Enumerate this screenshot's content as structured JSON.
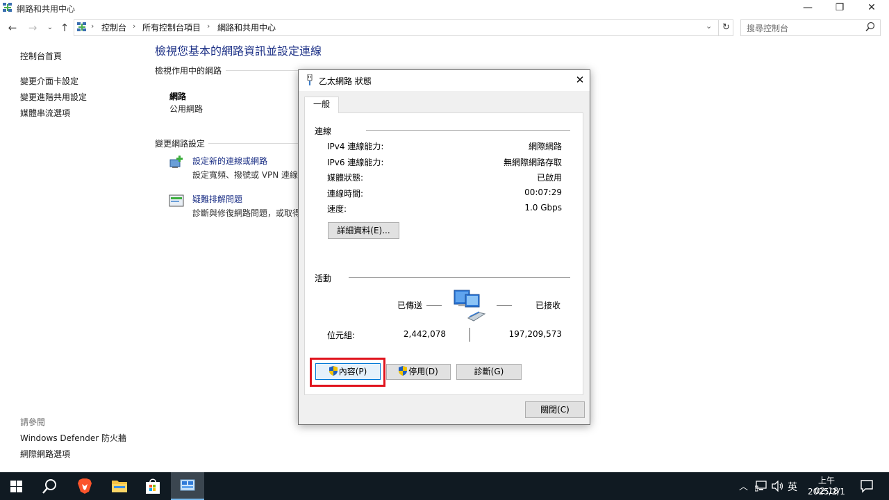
{
  "window": {
    "title": "網路和共用中心",
    "minimize_glyph": "—",
    "maximize_glyph": "❐",
    "close_glyph": "✕"
  },
  "address": {
    "crumbs": [
      "控制台",
      "所有控制台項目",
      "網路和共用中心"
    ],
    "separator": "›"
  },
  "search": {
    "placeholder": "搜尋控制台"
  },
  "leftnav": {
    "home": "控制台首頁",
    "links": [
      "變更介面卡設定",
      "變更進階共用設定",
      "媒體串流選項"
    ],
    "see_also_label": "請參閱",
    "see_also": [
      "Windows Defender 防火牆",
      "網際網路選項"
    ]
  },
  "main": {
    "title": "檢視您基本的網路資訊並設定連線",
    "active_networks_heading": "檢視作用中的網路",
    "network_name": "網路",
    "network_type": "公用網路",
    "change_settings_heading": "變更網路設定",
    "tasks": [
      {
        "link": "設定新的連線或網路",
        "desc": "設定寬頻、撥號或 VPN 連線"
      },
      {
        "link": "疑難排解問題",
        "desc": "診斷與修復網路問題，或取得"
      }
    ]
  },
  "dialog": {
    "title": "乙太網路 狀態",
    "tab": "一般",
    "connection_group": "連線",
    "rows": [
      {
        "key": "IPv4 連線能力:",
        "value": "網際網路"
      },
      {
        "key": "IPv6 連線能力:",
        "value": "無網際網路存取"
      },
      {
        "key": "媒體狀態:",
        "value": "已啟用"
      },
      {
        "key": "連線時間:",
        "value": "00:07:29"
      },
      {
        "key": "速度:",
        "value": "1.0 Gbps"
      }
    ],
    "details_button": "詳細資料(E)...",
    "activity_group": "活動",
    "sent_label": "已傳送",
    "received_label": "已接收",
    "bytes_label": "位元組:",
    "bytes_sent": "2,442,078",
    "bytes_received": "197,209,573",
    "properties_button": "內容(P)",
    "disable_button": "停用(D)",
    "diagnose_button": "診斷(G)",
    "close_button": "關閉(C)"
  },
  "taskbar": {
    "ime": "英",
    "time": "上午 02:18",
    "date": "2025/2/1"
  },
  "colors": {
    "link": "#1e3287",
    "highlight": "#e0141d",
    "taskbar": "#101a22"
  }
}
